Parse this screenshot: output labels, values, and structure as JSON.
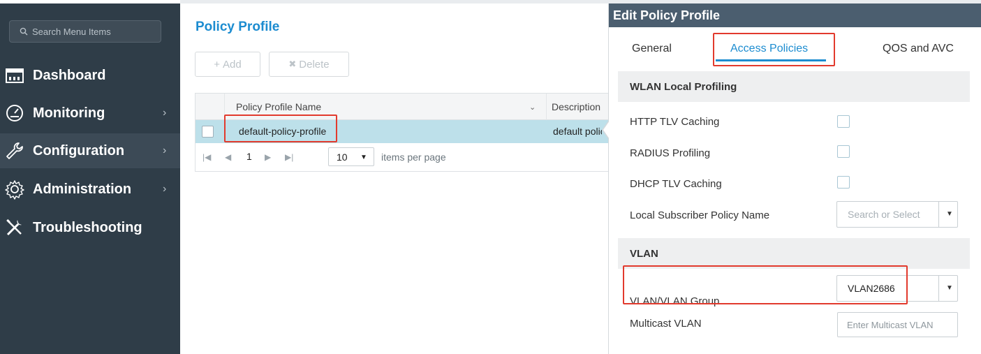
{
  "sidebar": {
    "search_placeholder": "Search Menu Items",
    "items": [
      {
        "label": "Dashboard",
        "icon": "dashboard-icon",
        "has_chevron": false
      },
      {
        "label": "Monitoring",
        "icon": "gauge-icon",
        "has_chevron": true
      },
      {
        "label": "Configuration",
        "icon": "wrench-icon",
        "has_chevron": true,
        "active": true
      },
      {
        "label": "Administration",
        "icon": "gear-icon",
        "has_chevron": true
      },
      {
        "label": "Troubleshooting",
        "icon": "tools-icon",
        "has_chevron": false
      }
    ],
    "chevron": "›"
  },
  "main": {
    "title": "Policy Profile",
    "add_label": "Add",
    "delete_label": "Delete",
    "table": {
      "columns": [
        "Policy Profile Name",
        "Description"
      ],
      "rows": [
        {
          "name": "default-policy-profile",
          "description": "default policy profile"
        }
      ]
    },
    "pager": {
      "first": "|◀",
      "prev": "◀",
      "page": "1",
      "next": "▶",
      "last": "▶|",
      "per_page": "10",
      "per_page_label": "items per page"
    }
  },
  "panel": {
    "title": "Edit Policy Profile",
    "tabs": [
      {
        "label": "General"
      },
      {
        "label": "Access Policies",
        "active": true
      },
      {
        "label": "QOS and AVC"
      }
    ],
    "sections": {
      "wlan_local_profiling": "WLAN Local Profiling",
      "vlan": "VLAN"
    },
    "fields": {
      "http_tlv_caching": {
        "label": "HTTP TLV Caching",
        "checked": false
      },
      "radius_profiling": {
        "label": "RADIUS Profiling",
        "checked": false
      },
      "dhcp_tlv_caching": {
        "label": "DHCP TLV Caching",
        "checked": false
      },
      "local_subscriber_policy": {
        "label": "Local Subscriber Policy Name",
        "placeholder": "Search or Select"
      },
      "vlan_group": {
        "label": "VLAN/VLAN Group",
        "value": "VLAN2686"
      },
      "multicast_vlan": {
        "label": "Multicast VLAN",
        "placeholder": "Enter Multicast VLAN"
      }
    }
  },
  "colors": {
    "sidebar_bg": "#2f3d48",
    "accent": "#1c8cd0",
    "highlight": "#e23a2d",
    "selected_row": "#bde0ea",
    "panel_header": "#4b5e6f"
  }
}
